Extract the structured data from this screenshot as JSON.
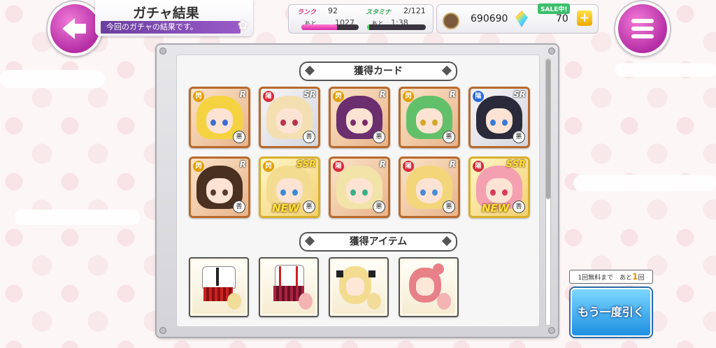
{
  "header": {
    "title": "ガチャ結果",
    "subtitle": "今回のガチャの結果です。"
  },
  "status": {
    "rank_label": "ランク",
    "rank_value": "92",
    "rank_next_label": "あと",
    "rank_next_value": "1027",
    "stamina_label": "スタミナ",
    "stamina_value": "2/121",
    "stamina_next_label": "あと",
    "stamina_next_value": "1:38"
  },
  "currency": {
    "coins": "690690",
    "gems": "70",
    "sale_badge": "SALE中!",
    "plus": "+"
  },
  "sections": {
    "cards_title": "獲得カード",
    "items_title": "獲得アイテム"
  },
  "cards": [
    {
      "rarity": "R",
      "attr": "閃",
      "attr_color": "#e0a000",
      "type": "悪",
      "hair": "#f5d340",
      "eye": "#3d6fd1",
      "new": ""
    },
    {
      "rarity": "SR",
      "attr": "陽",
      "attr_color": "#d82b3a",
      "type": "善",
      "hair": "#f3dfb0",
      "eye": "#b8324a",
      "new": ""
    },
    {
      "rarity": "R",
      "attr": "閃",
      "attr_color": "#e0a000",
      "type": "悪",
      "hair": "#6b2e6e",
      "eye": "#7a2a6a",
      "new": ""
    },
    {
      "rarity": "R",
      "attr": "閃",
      "attr_color": "#e0a000",
      "type": "悪",
      "hair": "#63c06a",
      "eye": "#d4a82a",
      "new": ""
    },
    {
      "rarity": "SR",
      "attr": "陰",
      "attr_color": "#2a6ad8",
      "type": "悪",
      "hair": "#2a2a3a",
      "eye": "#3a7ad8",
      "new": ""
    },
    {
      "rarity": "R",
      "attr": "閃",
      "attr_color": "#e0a000",
      "type": "善",
      "hair": "#4a3020",
      "eye": "#5a3a2a",
      "new": ""
    },
    {
      "rarity": "SSR",
      "attr": "閃",
      "attr_color": "#e0a000",
      "type": "悪",
      "hair": "#f3dc90",
      "eye": "#3a8ad8",
      "new": "NEW"
    },
    {
      "rarity": "R",
      "attr": "陽",
      "attr_color": "#d82b3a",
      "type": "悪",
      "hair": "#f2e4a8",
      "eye": "#3ab08a",
      "new": ""
    },
    {
      "rarity": "R",
      "attr": "陽",
      "attr_color": "#d82b3a",
      "type": "悪",
      "hair": "#f4d67a",
      "eye": "#4a8ad8",
      "new": ""
    },
    {
      "rarity": "SSR",
      "attr": "陽",
      "attr_color": "#d82b3a",
      "type": "善",
      "hair": "#f4a0b0",
      "eye": "#d83a5a",
      "new": "NEW"
    }
  ],
  "items": [
    {
      "name": "uniform-outfit-icon"
    },
    {
      "name": "skirt-outfit-icon"
    },
    {
      "name": "blonde-hairstyle-icon"
    },
    {
      "name": "pink-hairstyle-icon"
    }
  ],
  "actions": {
    "free_prefix": "1回無料まで　あと",
    "free_count": "1",
    "free_suffix": "回",
    "again_label": "もう一度引く"
  }
}
